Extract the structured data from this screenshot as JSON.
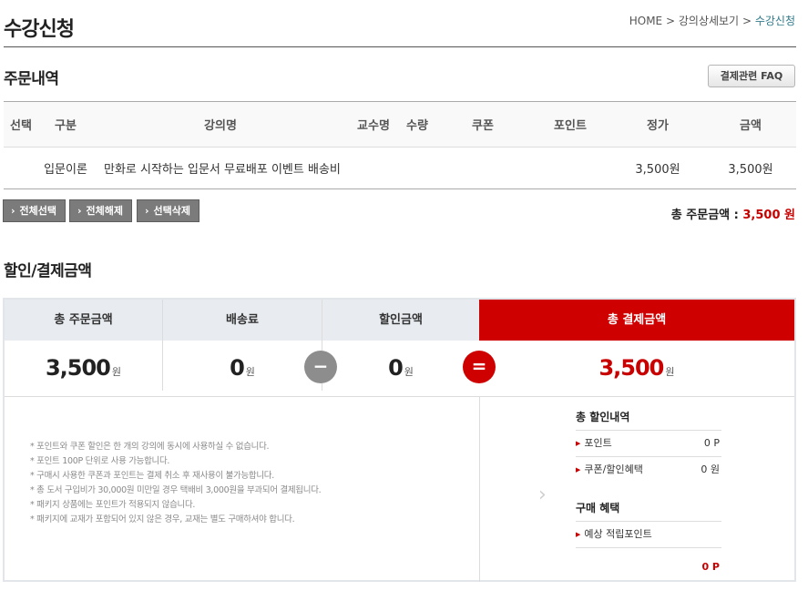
{
  "page_title": "수강신청",
  "breadcrumb": {
    "home": "HOME",
    "sep": ">",
    "item2": "강의상세보기",
    "current": "수강신청"
  },
  "order_section": {
    "title": "주문내역",
    "faq_label": "결제관련 FAQ",
    "columns": [
      "선택",
      "구분",
      "강의명",
      "교수명",
      "수량",
      "쿠폰",
      "포인트",
      "정가",
      "금액"
    ],
    "rows": [
      {
        "category": "입문이론",
        "name": "만화로 시작하는 입문서 무료배포 이벤트 배송비",
        "professor": "",
        "qty": "",
        "coupon": "",
        "point": "",
        "list_price": "3,500원",
        "amount": "3,500원"
      }
    ],
    "buttons": {
      "select_all": "전체선택",
      "deselect_all": "전체해제",
      "delete_selected": "선택삭제"
    },
    "total_label": "총 주문금액 :",
    "total_value": "3,500 원"
  },
  "payment_section": {
    "title": "할인/결제금액",
    "headers": {
      "order_total": "총 주문금액",
      "shipping": "배송료",
      "discount": "할인금액",
      "pay_total": "총 결제금액"
    },
    "values": {
      "order_total": "3,500",
      "shipping": "0",
      "discount": "0",
      "pay_total": "3,500"
    },
    "unit": "원",
    "minus_sign": "−",
    "equals_sign": "=",
    "notes": [
      "* 포인트와 쿠폰 할인은 한 개의 강의에 동시에 사용하실 수 없습니다.",
      "* 포인트 100P 단위로 사용 가능합니다.",
      "* 구매시 사용한 쿠폰과 포인트는 결제 취소 후 재사용이 불가능합니다.",
      "* 총 도서 구입비가 30,000원 미만일 경우 택배비 3,000원을 부과되어 결제됩니다.",
      "* 패키지 상품에는 포인트가 적용되지 않습니다.",
      "* 패키지에 교재가 포함되어 있지 않은 경우, 교재는 별도 구매하셔야 합니다."
    ],
    "summary": {
      "discount_title": "총 할인내역",
      "point_label": "포인트",
      "point_value": "0 P",
      "coupon_label": "쿠폰/할인혜택",
      "coupon_value": "0 원",
      "benefit_title": "구매 혜택",
      "expected_label": "예상 적립포인트",
      "expected_value": "0 P"
    }
  }
}
